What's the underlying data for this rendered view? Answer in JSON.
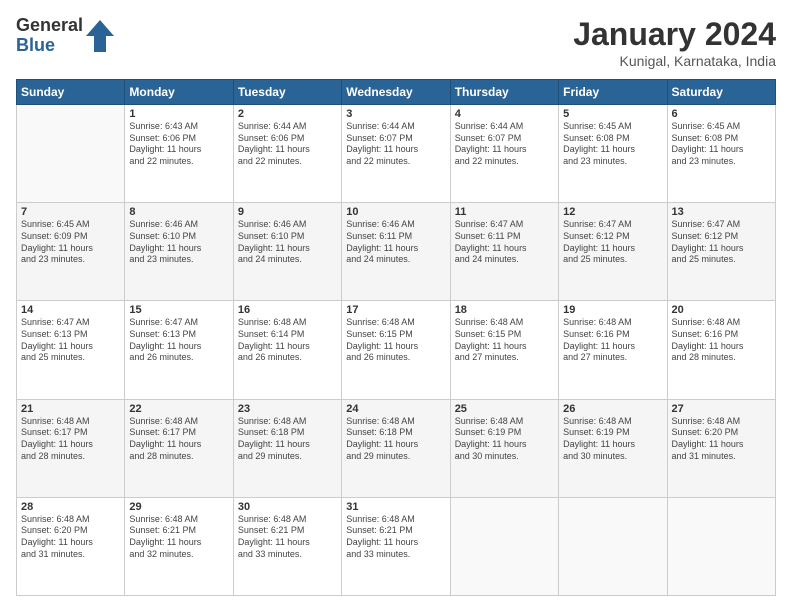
{
  "logo": {
    "general": "General",
    "blue": "Blue"
  },
  "title": "January 2024",
  "subtitle": "Kunigal, Karnataka, India",
  "weekdays": [
    "Sunday",
    "Monday",
    "Tuesday",
    "Wednesday",
    "Thursday",
    "Friday",
    "Saturday"
  ],
  "weeks": [
    [
      {
        "day": "",
        "info": ""
      },
      {
        "day": "1",
        "info": "Sunrise: 6:43 AM\nSunset: 6:06 PM\nDaylight: 11 hours\nand 22 minutes."
      },
      {
        "day": "2",
        "info": "Sunrise: 6:44 AM\nSunset: 6:06 PM\nDaylight: 11 hours\nand 22 minutes."
      },
      {
        "day": "3",
        "info": "Sunrise: 6:44 AM\nSunset: 6:07 PM\nDaylight: 11 hours\nand 22 minutes."
      },
      {
        "day": "4",
        "info": "Sunrise: 6:44 AM\nSunset: 6:07 PM\nDaylight: 11 hours\nand 22 minutes."
      },
      {
        "day": "5",
        "info": "Sunrise: 6:45 AM\nSunset: 6:08 PM\nDaylight: 11 hours\nand 23 minutes."
      },
      {
        "day": "6",
        "info": "Sunrise: 6:45 AM\nSunset: 6:08 PM\nDaylight: 11 hours\nand 23 minutes."
      }
    ],
    [
      {
        "day": "7",
        "info": "Sunrise: 6:45 AM\nSunset: 6:09 PM\nDaylight: 11 hours\nand 23 minutes."
      },
      {
        "day": "8",
        "info": "Sunrise: 6:46 AM\nSunset: 6:10 PM\nDaylight: 11 hours\nand 23 minutes."
      },
      {
        "day": "9",
        "info": "Sunrise: 6:46 AM\nSunset: 6:10 PM\nDaylight: 11 hours\nand 24 minutes."
      },
      {
        "day": "10",
        "info": "Sunrise: 6:46 AM\nSunset: 6:11 PM\nDaylight: 11 hours\nand 24 minutes."
      },
      {
        "day": "11",
        "info": "Sunrise: 6:47 AM\nSunset: 6:11 PM\nDaylight: 11 hours\nand 24 minutes."
      },
      {
        "day": "12",
        "info": "Sunrise: 6:47 AM\nSunset: 6:12 PM\nDaylight: 11 hours\nand 25 minutes."
      },
      {
        "day": "13",
        "info": "Sunrise: 6:47 AM\nSunset: 6:12 PM\nDaylight: 11 hours\nand 25 minutes."
      }
    ],
    [
      {
        "day": "14",
        "info": "Sunrise: 6:47 AM\nSunset: 6:13 PM\nDaylight: 11 hours\nand 25 minutes."
      },
      {
        "day": "15",
        "info": "Sunrise: 6:47 AM\nSunset: 6:13 PM\nDaylight: 11 hours\nand 26 minutes."
      },
      {
        "day": "16",
        "info": "Sunrise: 6:48 AM\nSunset: 6:14 PM\nDaylight: 11 hours\nand 26 minutes."
      },
      {
        "day": "17",
        "info": "Sunrise: 6:48 AM\nSunset: 6:15 PM\nDaylight: 11 hours\nand 26 minutes."
      },
      {
        "day": "18",
        "info": "Sunrise: 6:48 AM\nSunset: 6:15 PM\nDaylight: 11 hours\nand 27 minutes."
      },
      {
        "day": "19",
        "info": "Sunrise: 6:48 AM\nSunset: 6:16 PM\nDaylight: 11 hours\nand 27 minutes."
      },
      {
        "day": "20",
        "info": "Sunrise: 6:48 AM\nSunset: 6:16 PM\nDaylight: 11 hours\nand 28 minutes."
      }
    ],
    [
      {
        "day": "21",
        "info": "Sunrise: 6:48 AM\nSunset: 6:17 PM\nDaylight: 11 hours\nand 28 minutes."
      },
      {
        "day": "22",
        "info": "Sunrise: 6:48 AM\nSunset: 6:17 PM\nDaylight: 11 hours\nand 28 minutes."
      },
      {
        "day": "23",
        "info": "Sunrise: 6:48 AM\nSunset: 6:18 PM\nDaylight: 11 hours\nand 29 minutes."
      },
      {
        "day": "24",
        "info": "Sunrise: 6:48 AM\nSunset: 6:18 PM\nDaylight: 11 hours\nand 29 minutes."
      },
      {
        "day": "25",
        "info": "Sunrise: 6:48 AM\nSunset: 6:19 PM\nDaylight: 11 hours\nand 30 minutes."
      },
      {
        "day": "26",
        "info": "Sunrise: 6:48 AM\nSunset: 6:19 PM\nDaylight: 11 hours\nand 30 minutes."
      },
      {
        "day": "27",
        "info": "Sunrise: 6:48 AM\nSunset: 6:20 PM\nDaylight: 11 hours\nand 31 minutes."
      }
    ],
    [
      {
        "day": "28",
        "info": "Sunrise: 6:48 AM\nSunset: 6:20 PM\nDaylight: 11 hours\nand 31 minutes."
      },
      {
        "day": "29",
        "info": "Sunrise: 6:48 AM\nSunset: 6:21 PM\nDaylight: 11 hours\nand 32 minutes."
      },
      {
        "day": "30",
        "info": "Sunrise: 6:48 AM\nSunset: 6:21 PM\nDaylight: 11 hours\nand 33 minutes."
      },
      {
        "day": "31",
        "info": "Sunrise: 6:48 AM\nSunset: 6:21 PM\nDaylight: 11 hours\nand 33 minutes."
      },
      {
        "day": "",
        "info": ""
      },
      {
        "day": "",
        "info": ""
      },
      {
        "day": "",
        "info": ""
      }
    ]
  ]
}
